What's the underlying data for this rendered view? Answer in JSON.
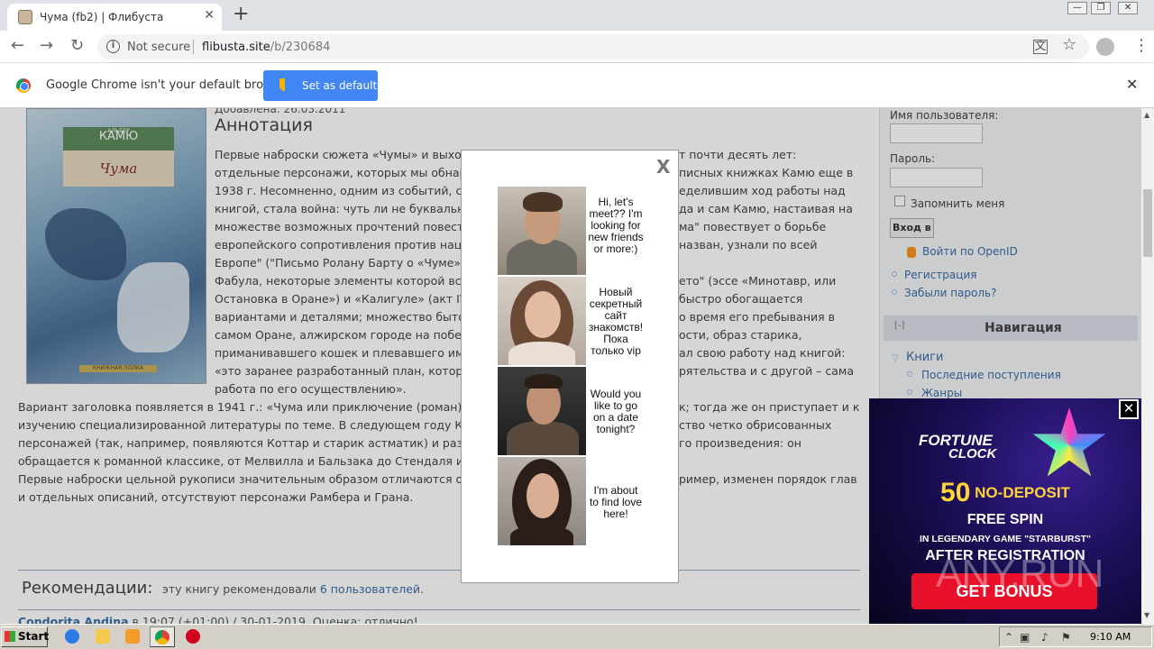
{
  "browser": {
    "tab_title": "Чума (fb2) | Флибуста",
    "tab_close": "✕",
    "new_tab": "+",
    "not_secure": "Not secure",
    "url_domain": "flibusta.site",
    "url_path": "/b/230684",
    "back": "←",
    "forward": "→",
    "reload": "↻",
    "translate_icon": "translate-icon",
    "star": "☆",
    "menu": "⋮",
    "win_min": "—",
    "win_max": "❐",
    "win_close": "✕"
  },
  "infobar": {
    "message": "Google Chrome isn't your default browser",
    "button": "Set as default",
    "close": "✕"
  },
  "book": {
    "cover_author_small": "АЛЬБЕР",
    "cover_author": "КАМЮ",
    "cover_title": "Чума",
    "cover_publisher": "КНИЖНАЯ ПОЛКА",
    "date_line": "Добавлена: 26.03.2011",
    "annotation_heading": "Аннотация",
    "annotation_lines": [
      "Первые наброски сюжета «Чумы» и выход",
      "отдельные персонажи, которых мы обнар",
      "1938 г. Несомненно, одним из событий, са",
      "книгой, стала война: чуть ли не буквальн",
      "множестве возможных прочтений повест",
      "европейского сопротивления против нац",
      "Европе\" (\"Письмо Ролану Барту о «Чуме»",
      "Фабула, некоторые элементы которой вст",
      "Остановка в Оране») и «Калигуле» (акт IV",
      "вариантами и деталями; множество быто",
      "самом Оране, алжирском городе на побер",
      "приманивавшего кошек и плевавшего им",
      "«это заранее разработанный план, котор",
      "работа по его осуществлению»."
    ],
    "annotation_right": [
      "т почти десять лет:",
      "писных книжках Камю еще в",
      "еделившим ход работы над",
      "да и сам Камю, настаивая на",
      "ма\" повествует о борьбе",
      " назван, узнали по всей",
      "",
      "ето\" (эссе «Минотавр, или",
      " быстро обогащается",
      "о время его пребывания в",
      "ости, образ старика,",
      "ал свою работу над книгой:",
      "рятельства и с другой – сама",
      ""
    ],
    "full_lines_left": [
      "Вариант заголовка появляется в 1941 г.: «Чума или приключение (роман)»",
      "изучению специализированной литературы по теме. В следующем году Ка",
      "персонажей (так, например, появляются Коттар и старик астматик) и разм",
      "обращается к романной классике, от Мелвилла и Бальзака до Стендаля и Ф",
      "Первые наброски цельной рукописи значительным образом отличаются от",
      "и отдельных описаний, отсутствуют персонажи Рамбера и Грана."
    ],
    "full_lines_right": [
      "к; тогда же он приступает и к",
      "ство четко обрисованных",
      "го произведения: он",
      "",
      "ример, изменен порядок глав",
      ""
    ],
    "recs_heading": "Рекомендации:",
    "recs_text": "эту книгу рекомендовали",
    "recs_link": "6 пользователей",
    "recs_end": ".",
    "comment_user": "Condorita Andina",
    "comment_rest": " в 19:07 (+01:00) / 30-01-2019, Оценка: отлично!"
  },
  "sidebar": {
    "username_label": "Имя пользователя:",
    "password_label": "Пароль:",
    "remember": "Запомнить меня",
    "login_button": "Вход в с",
    "openid": "Войти по OpenID",
    "register": "Регистрация",
    "forgot": "Забыли пароль?",
    "nav_collapse": "[-]",
    "nav_title": "Навигация",
    "books": "Книги",
    "latest": "Последние поступления",
    "genres": "Жанры"
  },
  "popup": {
    "close": "X",
    "profiles": [
      {
        "text": "Hi, let's meet?? I'm looking for new friends or more:)"
      },
      {
        "text": "Новый секретный сайт знакомств! Пока только vip"
      },
      {
        "text": "Would you like to go on a date tonight?"
      },
      {
        "text": "I'm about to find love here!"
      }
    ]
  },
  "ad": {
    "close": "✕",
    "brand_1": "FORTUNE",
    "brand_2": "CLOCK",
    "amount": "50",
    "nodeposit": "NO-DEPOSIT",
    "free_spin": "FREE SPIN",
    "game": "IN LEGENDARY GAME \"STARBURST\"",
    "after": "AFTER REGISTRATION",
    "button": "GET BONUS",
    "watermark": "ANY.RUN"
  },
  "taskbar": {
    "start": "Start",
    "time": "9:10 AM"
  }
}
